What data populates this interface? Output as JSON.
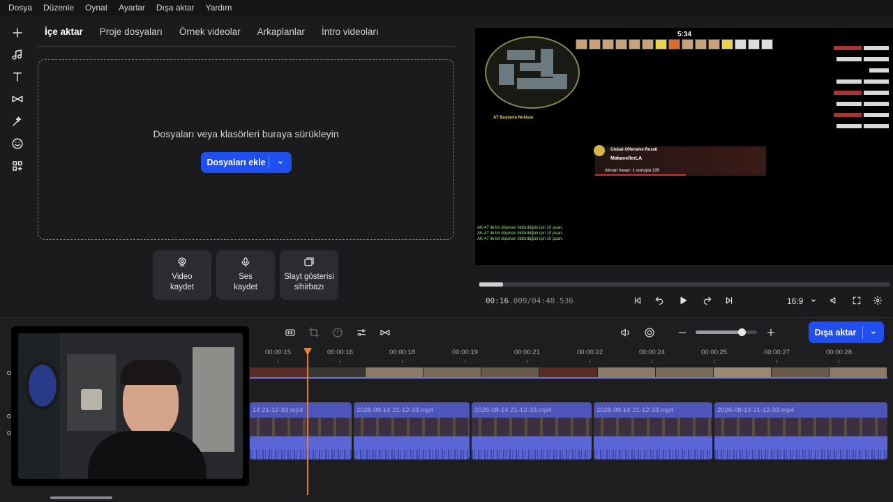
{
  "menu": [
    "Dosya",
    "Düzenle",
    "Oynat",
    "Ayarlar",
    "Dışa aktar",
    "Yardım"
  ],
  "rail": [
    {
      "name": "plus-icon"
    },
    {
      "name": "music-note-icon"
    },
    {
      "name": "text-icon"
    },
    {
      "name": "transition-icon"
    },
    {
      "name": "effects-wand-icon"
    },
    {
      "name": "sticker-smile-icon"
    },
    {
      "name": "templates-grid-icon"
    }
  ],
  "tabs": [
    "İçe aktar",
    "Proje dosyaları",
    "Örnek videolar",
    "Arkaplanlar",
    "İntro videoları"
  ],
  "dropzone": {
    "text": "Dosyaları veya klasörleri buraya sürükleyin",
    "add_label": "Dosyaları ekle"
  },
  "quick_actions": [
    {
      "label": "Video\nkaydet",
      "icon": "webcam-icon"
    },
    {
      "label": "Ses\nkaydet",
      "icon": "microphone-icon"
    },
    {
      "label": "Slayt gösterisi\nsihirbazı",
      "icon": "slideshow-icon"
    }
  ],
  "preview": {
    "hud_time": "5:34",
    "hud_spawn": "AT Başlama Noktası",
    "badge_title": "Global Offensive Rozeti",
    "badge_name": "MakavellerLA",
    "badge_sub": "Alınan hasar: 1 vuruşta 135",
    "chat": [
      "AK-47 ile bir düşman öldürdüğün için 10 puan.",
      "AK-47 ile bir düşman öldürdüğün için 10 puan.",
      "AK-47 ile bir düşman öldürdüğün için 10 puan."
    ],
    "progress": 0.057
  },
  "player": {
    "current": "00:16",
    "current_ms": ".009",
    "total": "/04:48.536",
    "ratio": "16:9"
  },
  "timeline": {
    "ruler": [
      "00:00:15",
      "00:00:16",
      "00:00:18",
      "00:00:19",
      "00:00:21",
      "00:00:22",
      "00:00:24",
      "00:00:25",
      "00:00:27",
      "00:00:28"
    ],
    "clips": [
      "14 21-12-33.mp4",
      "2026-08-14 21-12-33.mp4",
      "2026-08-14 21-12-33.mp4",
      "2026-08-14 21-12-33.mp4",
      "2026-08-14 21-12-33.mp4"
    ],
    "export_label": "Dışa aktar",
    "zoom": 0.75
  },
  "colors": {
    "accent": "#1f4ff0",
    "clip": "#4d55b8",
    "playhead": "#f07b2a"
  }
}
